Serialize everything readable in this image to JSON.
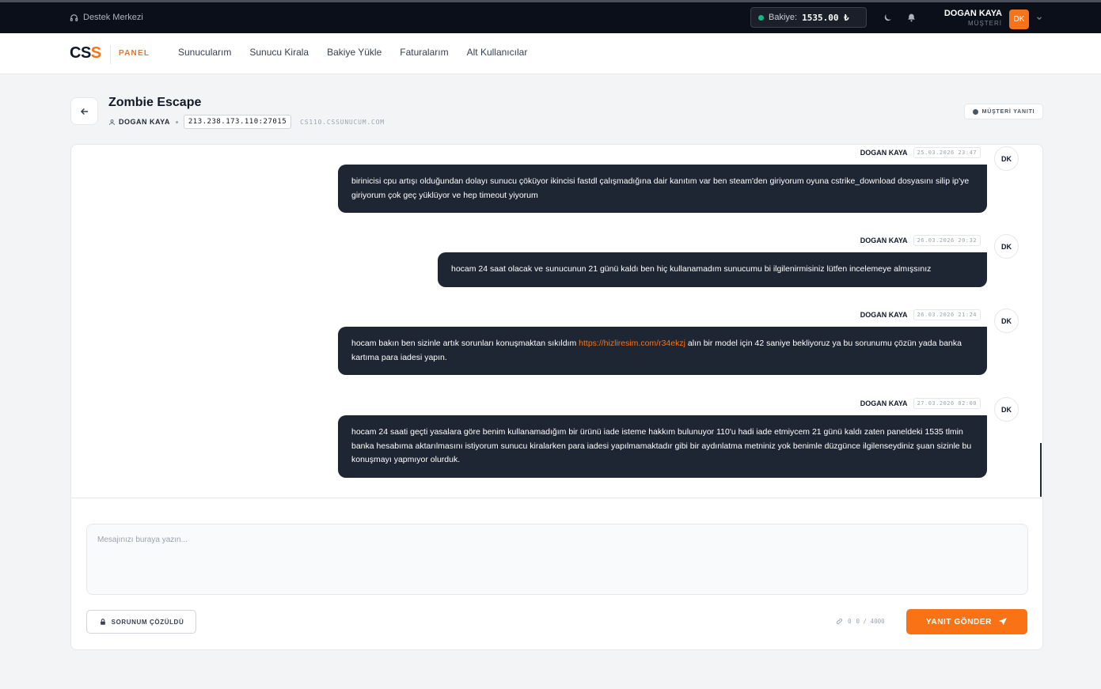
{
  "topbar": {
    "support_label": "Destek Merkezi",
    "balance_label": "Bakiye:",
    "balance_value": "1535.00 ₺",
    "user_name": "DOGAN KAYA",
    "user_role": "MÜŞTERİ",
    "user_initials": "DK"
  },
  "nav": {
    "logo_main": "CS",
    "logo_accent": "S",
    "panel_label": "PANEL",
    "items": [
      {
        "label": "Sunucularım"
      },
      {
        "label": "Sunucu Kirala"
      },
      {
        "label": "Bakiye Yükle"
      },
      {
        "label": "Faturalarım"
      },
      {
        "label": "Alt Kullanıcılar"
      }
    ]
  },
  "ticket": {
    "title": "Zombie Escape",
    "owner": "DOGAN KAYA",
    "ip": "213.238.173.110:27015",
    "host": "CS110.CSSUNUCUM.COM",
    "status": "MÜŞTERİ YANITI"
  },
  "messages": [
    {
      "author": "DOGAN KAYA",
      "time": "25.03.2026 23:47",
      "initials": "DK",
      "text": "birinicisi cpu artışı olduğundan dolayı sunucu çöküyor ikincisi fastdl çalışmadığına dair kanıtım var ben steam'den giriyorum oyuna cstrike_download dosyasını silip ip'ye giriyorum çok geç yüklüyor ve hep timeout yiyorum"
    },
    {
      "author": "DOGAN KAYA",
      "time": "26.03.2026 20:32",
      "initials": "DK",
      "text": "hocam 24 saat olacak ve sunucunun 21 günü kaldı ben hiç kullanamadım sunucumu bi ilgilenirmisiniz lütfen incelemeye almışsınız"
    },
    {
      "author": "DOGAN KAYA",
      "time": "26.03.2026 21:24",
      "initials": "DK",
      "text_before": "hocam bakın ben sizinle artık sorunları konuşmaktan sıkıldım ",
      "link": "https://hizliresim.com/r34ekzj",
      "text_after": " alın bir model için 42 saniye bekliyoruz ya bu sorunumu çözün yada banka kartıma para iadesi yapın."
    },
    {
      "author": "DOGAN KAYA",
      "time": "27.03.2026 02:00",
      "initials": "DK",
      "text": "hocam 24 saati geçti yasalara göre benim kullanamadığım bir ürünü iade isteme hakkım bulunuyor 110'u hadi iade etmiycem 21 günü kaldı zaten paneldeki 1535 tlmin banka hesabıma aktarılmasını istiyorum sunucu kiralarken para iadesi yapılmamaktadır gibi bir aydınlatma metniniz yok benimle düzgünce ilgilenseydiniz şuan sizinle bu konuşmayı yapmıyor olurduk."
    }
  ],
  "composer": {
    "placeholder": "Mesajınızı buraya yazın...",
    "solved_label": "SORUNUM ÇÖZÜLDÜ",
    "attach_count": "0",
    "char_count": "0 / 4000",
    "send_label": "YANIT GÖNDER"
  },
  "colors": {
    "accent": "#f97316",
    "topbar_bg": "#0b0f19",
    "bubble_bg": "#1e2533",
    "online": "#10b981"
  }
}
